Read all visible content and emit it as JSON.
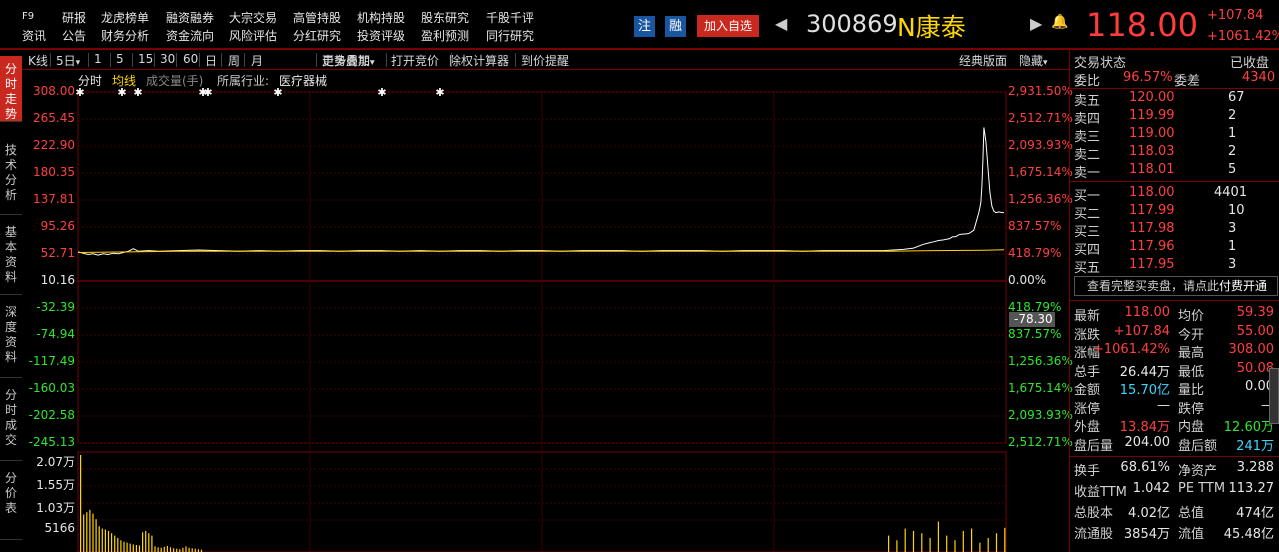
{
  "topnav": {
    "row1": [
      "F9",
      "研报",
      "龙虎榜单",
      "融资融券",
      "大宗交易",
      "高管持股",
      "机构持股",
      "股东研究",
      "千股千评"
    ],
    "row2": [
      "资讯",
      "公告",
      "财务分析",
      "资金流向",
      "风险评估",
      "分红研究",
      "投资评级",
      "盈利预测",
      "同行研究"
    ]
  },
  "header": {
    "zhu": "注",
    "rong": "融",
    "add_watch": "加入自选",
    "code": "300869",
    "name": "N康泰",
    "price": "118.00",
    "change": "+107.84",
    "change_pct": "+1061.42%"
  },
  "lefttabs": [
    "分时走势",
    "技术分析",
    "基本资料",
    "深度资料",
    "分时成交",
    "分价表"
  ],
  "toolbar": {
    "items": [
      "K线",
      "5日",
      "1",
      "5",
      "15",
      "30",
      "60",
      "日",
      "周",
      "月",
      "更多周期",
      "走势叠加",
      "打开竞价",
      "除权计算器",
      "到价提醒"
    ],
    "right": [
      "经典版面",
      "隐藏"
    ]
  },
  "subbar": {
    "fenshi": "分时",
    "junxian": "均线",
    "volume": "成交量(手)",
    "industry_label": "所属行业:",
    "industry": "医疗器械"
  },
  "chart_data": {
    "type": "line",
    "title": "",
    "prev_close": 10.16,
    "y_left_ticks": [
      "308.00",
      "265.45",
      "222.90",
      "180.35",
      "137.81",
      "95.26",
      "52.71",
      "10.16",
      "-32.39",
      "-74.94",
      "-117.49",
      "-160.03",
      "-202.58",
      "-245.13"
    ],
    "y_right_ticks": [
      "2,931.50%",
      "2,512.71%",
      "2,093.93%",
      "1,675.14%",
      "1,256.36%",
      "837.57%",
      "418.79%",
      "0.00%",
      "418.79%",
      "837.57%",
      "1,256.36%",
      "1,675.14%",
      "2,093.93%",
      "2,512.71%"
    ],
    "cursor_value": "-78.30",
    "volume_ticks": [
      "2.07万",
      "1.55万",
      "1.03万",
      "5166"
    ],
    "ylim": [
      -245.13,
      308.0
    ],
    "price_series": {
      "name": "price",
      "x": [
        0,
        5,
        10,
        15,
        20,
        25,
        30,
        35,
        40,
        45,
        50,
        55,
        60,
        70,
        80,
        100,
        120,
        140,
        160,
        180,
        200,
        220,
        240,
        260,
        280,
        300,
        320,
        340,
        360,
        380,
        400,
        420,
        440,
        460,
        480,
        500,
        520,
        540,
        560,
        580,
        600,
        620,
        640,
        660,
        680,
        700,
        720,
        740,
        760,
        780,
        800,
        810,
        820,
        830,
        835,
        840,
        845,
        850,
        855,
        860,
        863,
        866,
        869,
        872,
        875,
        878,
        880,
        885,
        890,
        895,
        896,
        897,
        898,
        899,
        900,
        902,
        904,
        906,
        908,
        910,
        912,
        915,
        918,
        920
      ],
      "values": [
        56,
        54,
        52,
        53,
        51,
        53,
        52,
        54,
        53,
        55,
        57,
        61,
        57,
        58,
        57,
        58,
        59,
        58,
        57,
        58,
        57,
        58,
        58,
        57,
        58,
        58,
        57,
        58,
        57,
        58,
        58,
        57,
        58,
        58,
        57,
        58,
        58,
        58,
        57,
        58,
        58,
        58,
        57,
        58,
        58,
        58,
        57,
        58,
        58,
        58,
        58,
        59,
        60,
        62,
        65,
        68,
        70,
        72,
        74,
        75,
        76,
        77,
        80,
        80,
        83,
        84,
        84,
        85,
        90,
        118,
        125,
        135,
        160,
        200,
        252,
        230,
        190,
        150,
        128,
        120,
        118,
        119,
        118,
        118
      ]
    },
    "avg_series": {
      "name": "avg",
      "x": [
        0,
        50,
        100,
        200,
        300,
        400,
        500,
        600,
        700,
        800,
        850,
        900,
        920
      ],
      "values": [
        55,
        56,
        57,
        57,
        57,
        57,
        57,
        57,
        57,
        57,
        58,
        58.5,
        59.39
      ]
    },
    "volume_first": [
      20700,
      8000,
      8500,
      9000,
      8200,
      7000,
      5500,
      5000,
      4800,
      4500,
      4000,
      3500,
      3000,
      2500,
      2200,
      2000,
      1800,
      1600,
      1500,
      1400,
      4200,
      4500,
      4000,
      3500,
      1200,
      1000,
      900,
      1100,
      1300,
      1000,
      800,
      700,
      600,
      900,
      1200,
      900,
      800,
      700,
      600,
      500
    ],
    "volume_late": [
      3500,
      2500,
      5000,
      4500,
      4000,
      3000,
      6500,
      3500,
      2500,
      4500,
      5000,
      2000,
      3000,
      4000,
      5166
    ]
  },
  "right": {
    "status_label": "交易状态",
    "status_value": "已收盘",
    "weibi_label": "委比",
    "weibi_value": "96.57%",
    "weicha_label": "委差",
    "weicha_value": "4340",
    "asks": [
      {
        "label": "卖五",
        "price": "120.00",
        "vol": "67"
      },
      {
        "label": "卖四",
        "price": "119.99",
        "vol": "2"
      },
      {
        "label": "卖三",
        "price": "119.00",
        "vol": "1"
      },
      {
        "label": "卖二",
        "price": "118.03",
        "vol": "2"
      },
      {
        "label": "卖一",
        "price": "118.01",
        "vol": "5"
      }
    ],
    "bids": [
      {
        "label": "买一",
        "price": "118.00",
        "vol": "4401"
      },
      {
        "label": "买二",
        "price": "117.99",
        "vol": "10"
      },
      {
        "label": "买三",
        "price": "117.98",
        "vol": "3"
      },
      {
        "label": "买四",
        "price": "117.96",
        "vol": "1"
      },
      {
        "label": "买五",
        "price": "117.95",
        "vol": "3"
      }
    ],
    "full_book_text": "查看完整买卖盘，请点此",
    "pay_text": "付费开通",
    "stats": [
      {
        "l1": "最新",
        "v1": "118.00",
        "c1": "red",
        "l2": "均价",
        "v2": "59.39",
        "c2": "red"
      },
      {
        "l1": "涨跌",
        "v1": "+107.84",
        "c1": "red",
        "l2": "今开",
        "v2": "55.00",
        "c2": "red"
      },
      {
        "l1": "涨幅",
        "v1": "+1061.42%",
        "c1": "red",
        "l2": "最高",
        "v2": "308.00",
        "c2": "red"
      },
      {
        "l1": "总手",
        "v1": "26.44万",
        "c1": "white",
        "l2": "最低",
        "v2": "50.08",
        "c2": "red"
      },
      {
        "l1": "金额",
        "v1": "15.70亿",
        "c1": "cyan",
        "l2": "量比",
        "v2": "0.00",
        "c2": "white"
      },
      {
        "l1": "涨停",
        "v1": "—",
        "c1": "white",
        "l2": "跌停",
        "v2": "—",
        "c2": "white"
      },
      {
        "l1": "外盘",
        "v1": "13.84万",
        "c1": "red",
        "l2": "内盘",
        "v2": "12.60万",
        "c2": "green"
      },
      {
        "l1": "盘后量",
        "v1": "204.00",
        "c1": "white",
        "l2": "盘后额",
        "v2": "241万",
        "c2": "cyan"
      }
    ],
    "stats2": [
      {
        "l1": "换手",
        "v1": "68.61%",
        "l2": "净资产",
        "v2": "3.288"
      },
      {
        "l1": "收益TTM",
        "v1": "1.042",
        "l2": "PE TTM",
        "v2": "113.27"
      },
      {
        "l1": "总股本",
        "v1": "4.02亿",
        "l2": "总值",
        "v2": "474亿"
      },
      {
        "l1": "流通股",
        "v1": "3854万",
        "l2": "流值",
        "v2": "45.48亿"
      }
    ]
  }
}
